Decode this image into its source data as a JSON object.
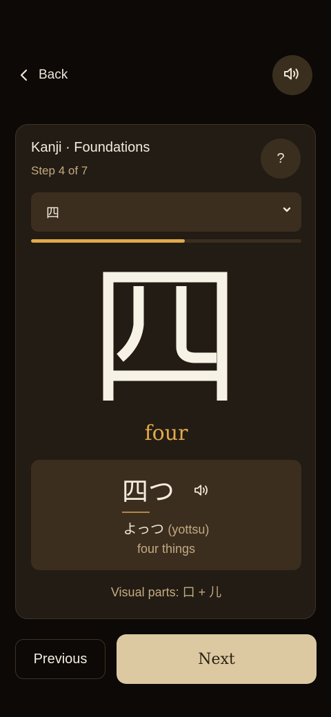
{
  "nav": {
    "back_label": "Back"
  },
  "icons": {
    "back": "chevron-left-icon",
    "audio": "speaker-icon",
    "select": "chevron-down-icon",
    "word_audio": "speaker-icon"
  },
  "colors": {
    "background": "#0c0906",
    "card": "#231c14",
    "accent": "#e2a94b",
    "primary_button": "#dcc9a1"
  },
  "lesson": {
    "title": "Kanji · Foundations",
    "step_label": "Step 4 of 7",
    "help_label": "?",
    "selected_kanji": "四",
    "progress_fraction": 0.57
  },
  "kanji": {
    "character": "四",
    "meaning": "four"
  },
  "example": {
    "word": "四つ",
    "kana": "よっつ",
    "romaji": "(yottsu)",
    "gloss": "four things"
  },
  "parts": {
    "text": "Visual parts: 口 + 儿"
  },
  "footer": {
    "previous_label": "Previous",
    "next_label": "Next"
  }
}
